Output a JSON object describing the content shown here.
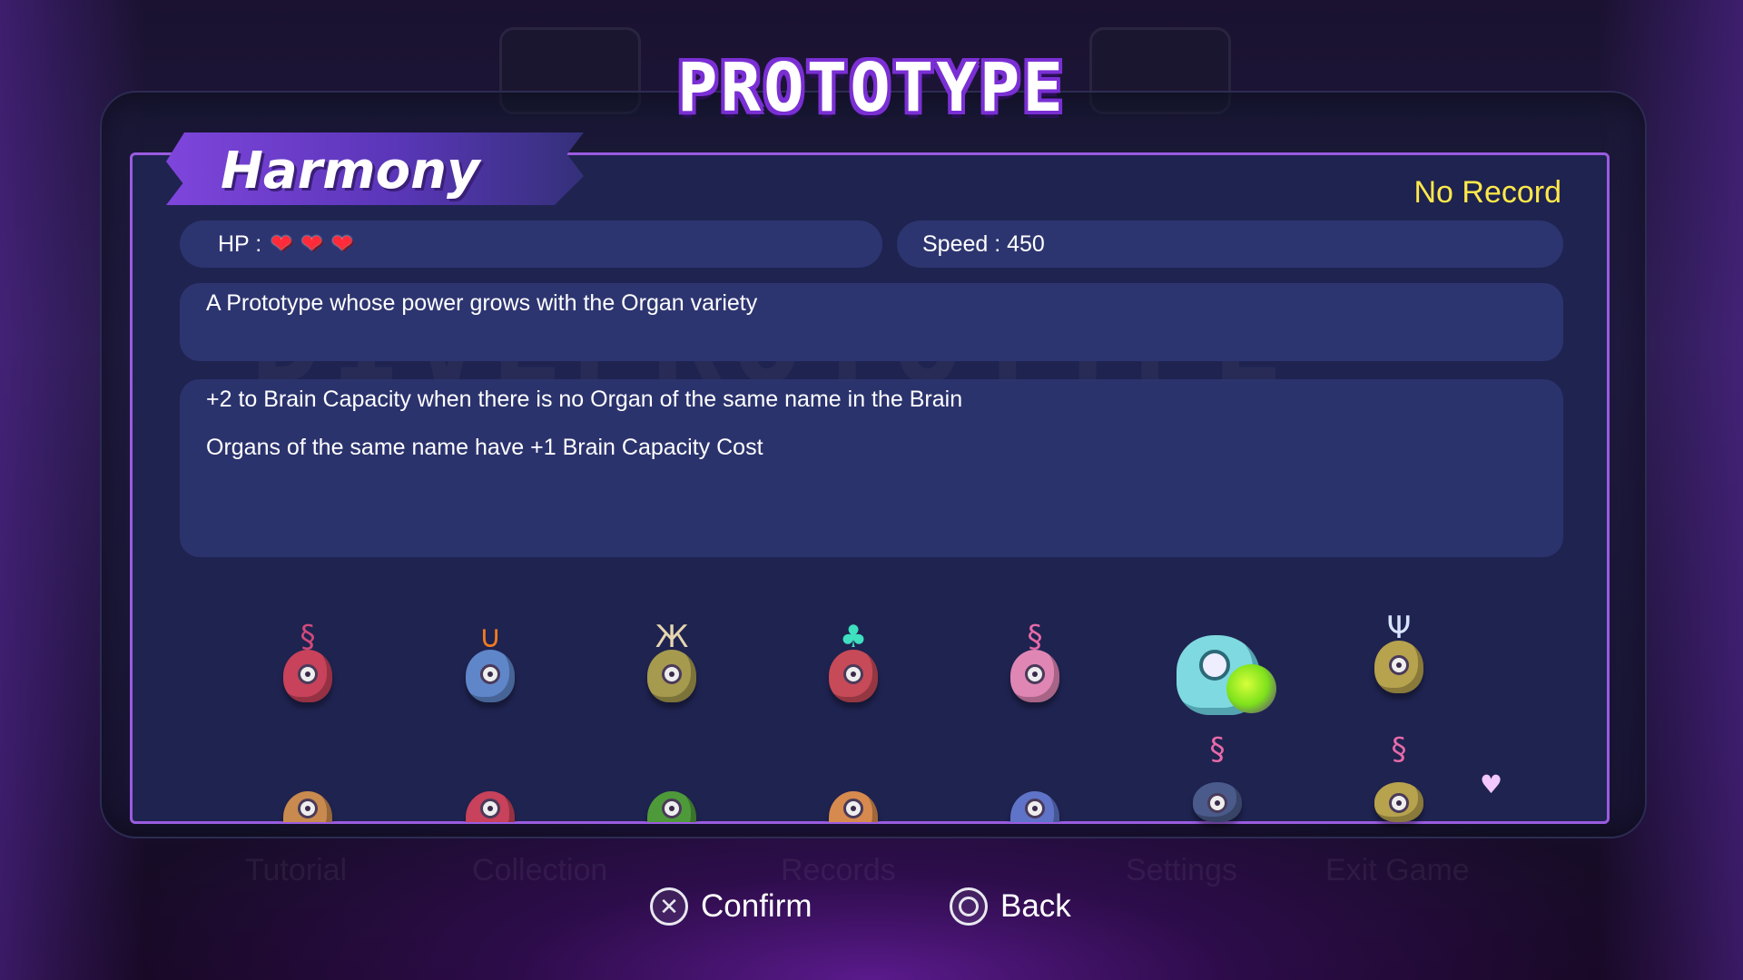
{
  "screen": {
    "title": "PROTOTYPE",
    "watermark": "DIVEPROTOTYPE"
  },
  "prototype": {
    "name": "Harmony",
    "record": "No Record",
    "hp_label": "HP :",
    "hp_hearts": 3,
    "speed_label": "Speed : 450",
    "description": "A Prototype whose power grows with the Organ variety",
    "effects": [
      "+2 to Brain Capacity when there is no Organ of the same name in the Brain",
      "Organs of the same name have +1 Brain Capacity Cost"
    ]
  },
  "organs": {
    "row1": [
      {
        "icon": "red-organ-icon",
        "color": "#c7425a",
        "top": "§"
      },
      {
        "icon": "blue-horned-organ-icon",
        "color": "#5f86c8",
        "top": "∪"
      },
      {
        "icon": "olive-organ-icon",
        "color": "#a69a4e",
        "top": "Ж"
      },
      {
        "icon": "red-crystal-organ-icon",
        "color": "#c74a58",
        "top": "♣"
      },
      {
        "icon": "pink-organ-icon",
        "color": "#e086b4",
        "top": "§"
      },
      {
        "icon": "olive-trident-organ-icon",
        "color": "#b7a24e",
        "top": "Ψ"
      }
    ],
    "row2": [
      {
        "icon": "orange-spiked-organ-icon",
        "color": "#c88a4e",
        "top": ""
      },
      {
        "icon": "red-small-organ-icon",
        "color": "#c7425a",
        "top": ""
      },
      {
        "icon": "green-organ-icon",
        "color": "#4e9a3a",
        "top": ""
      },
      {
        "icon": "orange-organ-icon",
        "color": "#d68a4e",
        "top": ""
      },
      {
        "icon": "blue-small-organ-icon",
        "color": "#5f74c8",
        "top": ""
      },
      {
        "icon": "blue-tentacle-organ-icon",
        "color": "#4a5a8a",
        "top": "§"
      },
      {
        "icon": "pink-tentacle-organ-icon",
        "color": "#e086b4",
        "top": "§"
      }
    ]
  },
  "footer": {
    "ghost_items": [
      "Tutorial",
      "Collection",
      "Records",
      "Settings",
      "Exit Game"
    ],
    "confirm_label": "Confirm",
    "back_label": "Back"
  }
}
